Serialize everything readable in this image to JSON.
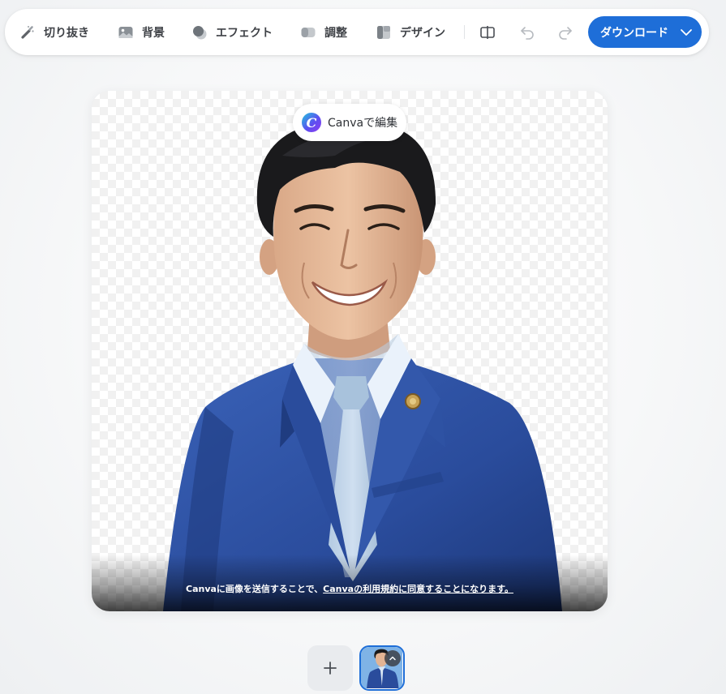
{
  "toolbar": {
    "cut_label": "切り抜き",
    "background_label": "背景",
    "effect_label": "エフェクト",
    "adjust_label": "調整",
    "design_label": "デザイン",
    "download_label": "ダウンロード"
  },
  "canvas": {
    "canva_edit_label": "Canvaで編集",
    "canva_logo_letter": "C",
    "terms_prefix": "Canvaに画像を送信することで、",
    "terms_link": "Canvaの利用規約に同意することになります。"
  },
  "thumbnails": {
    "add_symbol": "+"
  },
  "colors": {
    "accent": "#1e6ed8",
    "suit": "#2b4d9c",
    "shirt": "#d8e6f4"
  }
}
